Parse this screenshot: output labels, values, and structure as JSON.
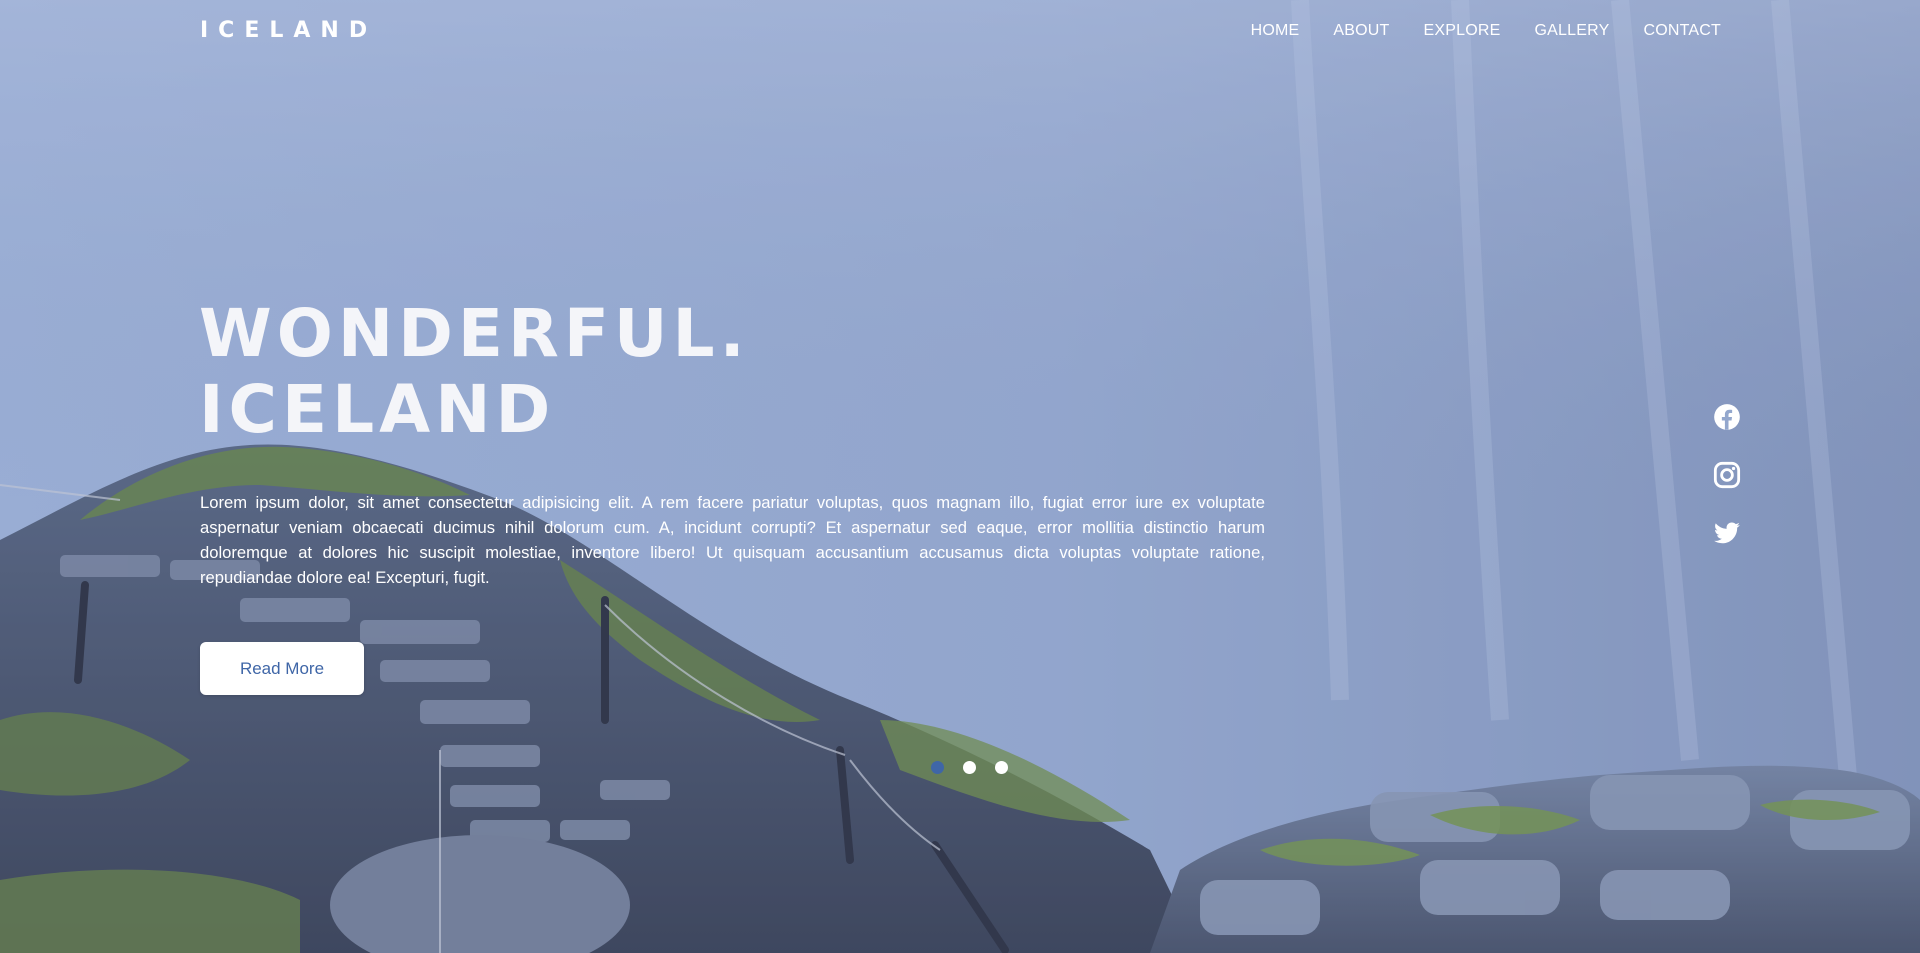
{
  "nav": {
    "logo": "ICELAND",
    "links": [
      "HOME",
      "ABOUT",
      "EXPLORE",
      "GALLERY",
      "CONTACT"
    ]
  },
  "hero": {
    "title_line1": "WONDERFUL.",
    "title_line2": "ICELAND",
    "description": "Lorem ipsum dolor, sit amet consectetur adipisicing elit. A rem facere pariatur voluptas, quos magnam illo, fugiat error iure ex voluptate aspernatur veniam obcaecati ducimus nihil dolorum cum. A, incidunt corrupti? Et aspernatur sed eaque, error mollitia distinctio harum doloremque at dolores hic suscipit molestiae, inventore libero! Ut quisquam accusantium accusamus dicta voluptas voluptate ratione, repudiandae dolore ea! Excepturi, fugit.",
    "button_label": "Read More"
  },
  "social": [
    "facebook-icon",
    "instagram-icon",
    "twitter-icon"
  ],
  "slider": {
    "count": 3,
    "active_index": 0
  },
  "colors": {
    "accent": "#3f66a7",
    "text": "#ffffff"
  }
}
